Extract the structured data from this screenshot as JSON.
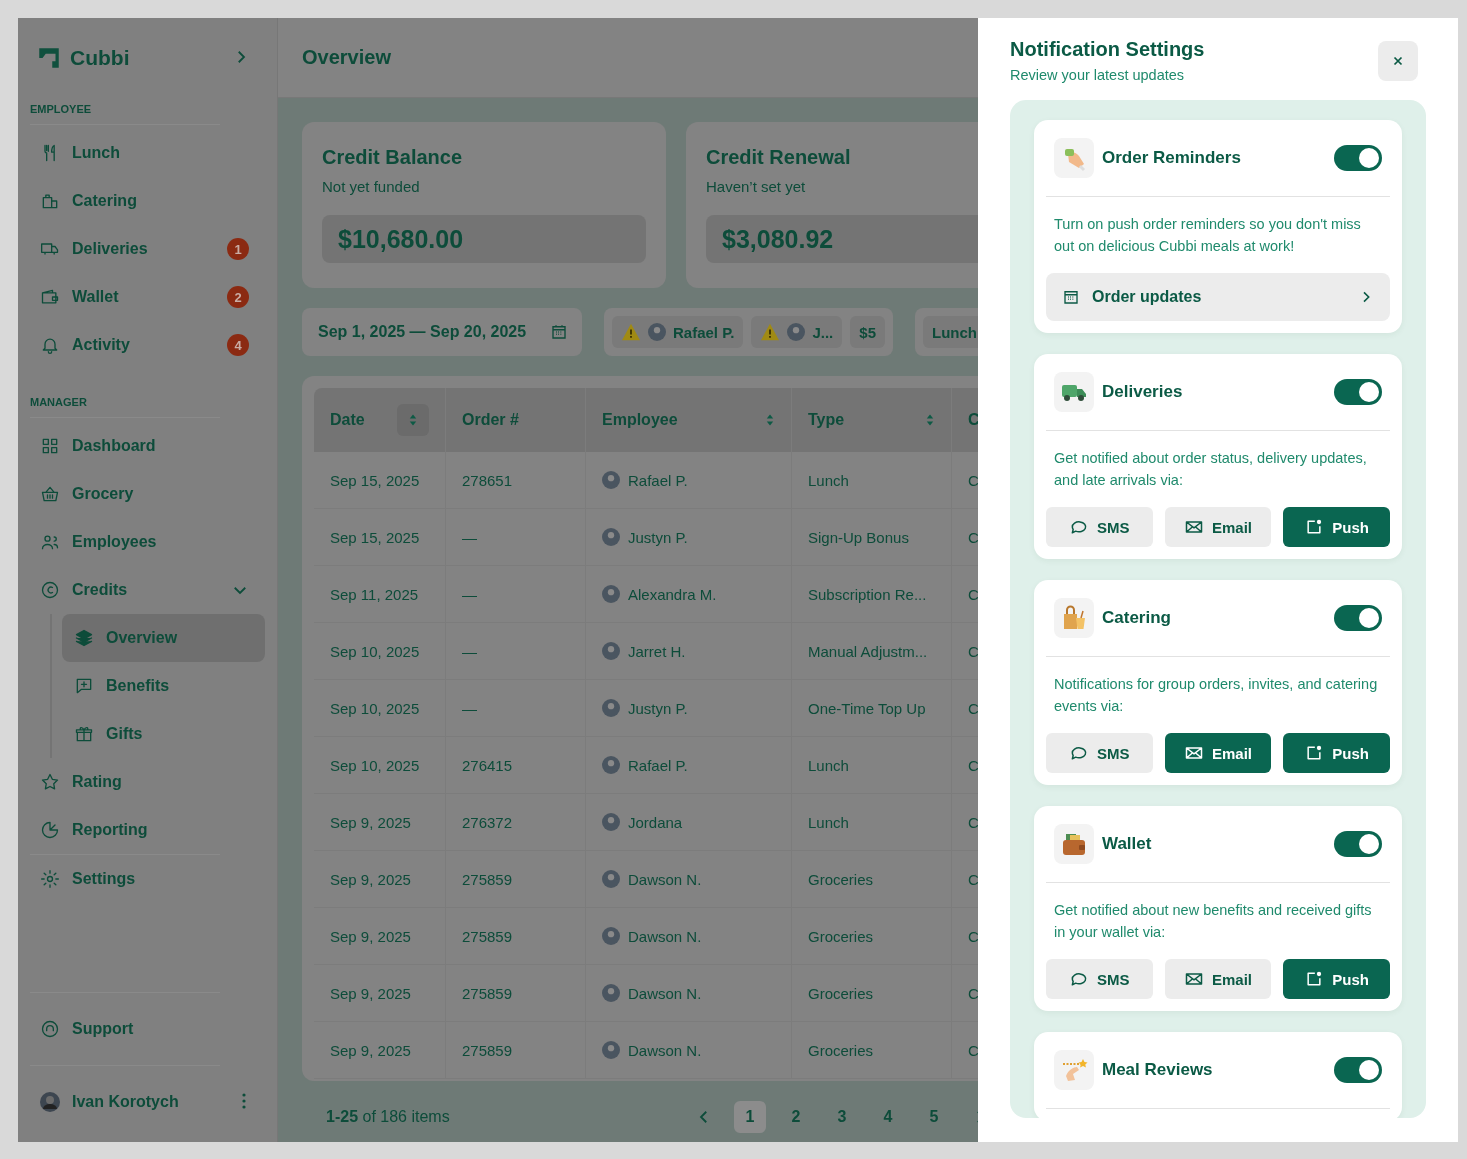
{
  "sidebar": {
    "brand": "Cubbi",
    "sections": [
      {
        "heading": "EMPLOYEE",
        "items": [
          {
            "label": "Lunch",
            "selected": false
          },
          {
            "label": "Catering",
            "selected": false
          },
          {
            "label": "Deliveries",
            "selected": false,
            "badge": "1"
          },
          {
            "label": "Wallet",
            "selected": false,
            "badge": "2"
          },
          {
            "label": "Activity",
            "selected": false,
            "badge": "4"
          }
        ]
      },
      {
        "heading": "MANAGER",
        "items": [
          {
            "label": "Dashboard",
            "selected": false
          },
          {
            "label": "Grocery",
            "selected": false
          },
          {
            "label": "Employees",
            "selected": false
          },
          {
            "label": "Credits",
            "selected": false,
            "expanded": true,
            "children": [
              {
                "label": "Overview",
                "selected": true
              },
              {
                "label": "Benefits",
                "selected": false
              },
              {
                "label": "Gifts",
                "selected": false
              }
            ]
          },
          {
            "label": "Rating",
            "selected": false
          },
          {
            "label": "Reporting",
            "selected": false
          }
        ]
      },
      {
        "items": [
          {
            "label": "Settings",
            "selected": false
          }
        ]
      }
    ],
    "support": "Support",
    "user": {
      "name": "Ivan Korotych"
    }
  },
  "page_title": "Overview",
  "cards": [
    {
      "title": "Credit Balance",
      "subtitle": "Not yet funded",
      "amount": "$10,680.00"
    },
    {
      "title": "Credit Renewal",
      "subtitle": "Haven’t set yet",
      "amount": "$3,080.92"
    }
  ],
  "filters": {
    "date_range": "Sep 1, 2025 — Sep 20, 2025",
    "chips": [
      {
        "kind": "person",
        "label": "Rafael P."
      },
      {
        "kind": "person",
        "label": "J..."
      },
      {
        "kind": "amount",
        "label": "$5"
      }
    ],
    "type_chip": "Lunch"
  },
  "table": {
    "columns": [
      {
        "label": "Date",
        "sortable": true,
        "sorted": true
      },
      {
        "label": "Order #",
        "sortable": false,
        "sorted": false
      },
      {
        "label": "Employee",
        "sortable": true,
        "sorted": false
      },
      {
        "label": "Type",
        "sortable": true,
        "sorted": false
      },
      {
        "label": "C",
        "sortable": false,
        "sorted": false
      }
    ],
    "rows": [
      {
        "date": "Sep 15, 2025",
        "order": "278651",
        "employee": "Rafael P.",
        "type": "Lunch",
        "column_5": "C"
      },
      {
        "date": "Sep 15, 2025",
        "order": "—",
        "employee": "Justyn P.",
        "type": "Sign-Up Bonus",
        "column_5": "C"
      },
      {
        "date": "Sep 11, 2025",
        "order": "—",
        "employee": "Alexandra M.",
        "type": "Subscription Re...",
        "column_5": "C"
      },
      {
        "date": "Sep 10, 2025",
        "order": "—",
        "employee": "Jarret H.",
        "type": "Manual Adjustm...",
        "column_5": "C"
      },
      {
        "date": "Sep 10, 2025",
        "order": "—",
        "employee": "Justyn P.",
        "type": "One-Time Top Up",
        "column_5": "C"
      },
      {
        "date": "Sep 10, 2025",
        "order": "276415",
        "employee": "Rafael P.",
        "type": "Lunch",
        "column_5": "C"
      },
      {
        "date": "Sep 9, 2025",
        "order": "276372",
        "employee": "Jordana",
        "type": "Lunch",
        "column_5": "C"
      },
      {
        "date": "Sep 9, 2025",
        "order": "275859",
        "employee": "Dawson N.",
        "type": "Groceries",
        "column_5": "C"
      },
      {
        "date": "Sep 9, 2025",
        "order": "275859",
        "employee": "Dawson N.",
        "type": "Groceries",
        "column_5": "C"
      },
      {
        "date": "Sep 9, 2025",
        "order": "275859",
        "employee": "Dawson N.",
        "type": "Groceries",
        "column_5": "C"
      },
      {
        "date": "Sep 9, 2025",
        "order": "275859",
        "employee": "Dawson N.",
        "type": "Groceries",
        "column_5": "C"
      }
    ]
  },
  "pagination": {
    "summary": "**1-25** of 186 items",
    "pages": [
      {
        "label": "1",
        "selected": true
      },
      {
        "label": "2",
        "selected": false
      },
      {
        "label": "3",
        "selected": false
      },
      {
        "label": "4",
        "selected": false
      },
      {
        "label": "5",
        "selected": false
      }
    ]
  },
  "drawer": {
    "title": "Notification Settings",
    "subtitle": "Review your latest updates",
    "categories": [
      {
        "title": "Order Reminders",
        "on": true,
        "kind": "link",
        "description": "Turn on push order reminders so you don't miss out on delicious Cubbi meals at work!",
        "link": "Order updates"
      },
      {
        "title": "Deliveries",
        "on": true,
        "kind": "channels",
        "description": "Get notified about order status, delivery updates, and late arrivals via:",
        "channels": [
          {
            "label": "SMS",
            "selected": false
          },
          {
            "label": "Email",
            "selected": false
          },
          {
            "label": "Push",
            "selected": true
          }
        ]
      },
      {
        "title": "Catering",
        "on": true,
        "kind": "channels",
        "description": "Notifications for group orders, invites, and catering events via:",
        "channels": [
          {
            "label": "SMS",
            "selected": false
          },
          {
            "label": "Email",
            "selected": true
          },
          {
            "label": "Push",
            "selected": true
          }
        ]
      },
      {
        "title": "Wallet",
        "on": true,
        "kind": "channels",
        "description": "Get notified about new benefits and received gifts in your wallet via:",
        "channels": [
          {
            "label": "SMS",
            "selected": false
          },
          {
            "label": "Email",
            "selected": false
          },
          {
            "label": "Push",
            "selected": true
          }
        ]
      },
      {
        "title": "Meal Reviews",
        "on": true,
        "kind": "header"
      }
    ]
  }
}
